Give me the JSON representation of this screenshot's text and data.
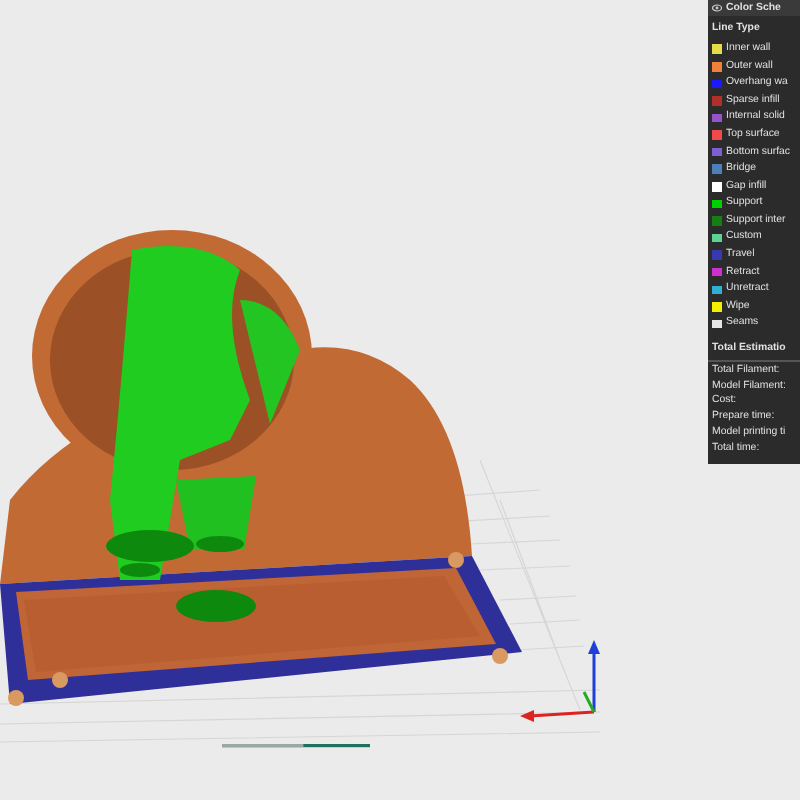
{
  "legend": {
    "title": "Color Sche",
    "section": "Line Type",
    "items": [
      {
        "label": "Inner wall",
        "color": "#e6dc4a"
      },
      {
        "label": "Outer wall",
        "color": "#f0803a"
      },
      {
        "label": "Overhang wa",
        "color": "#1a1aff"
      },
      {
        "label": "Sparse infill",
        "color": "#b03029"
      },
      {
        "label": "Internal solid",
        "color": "#9654cc"
      },
      {
        "label": "Top surface",
        "color": "#f04a4a"
      },
      {
        "label": "Bottom surfac",
        "color": "#7d5fd0"
      },
      {
        "label": "Bridge",
        "color": "#4d80ba"
      },
      {
        "label": "Gap infill",
        "color": "#ffffff"
      },
      {
        "label": "Support",
        "color": "#00d000"
      },
      {
        "label": "Support inter",
        "color": "#128012"
      },
      {
        "label": "Custom",
        "color": "#5ed194"
      },
      {
        "label": "Travel",
        "color": "#3838b0"
      },
      {
        "label": "Retract",
        "color": "#d030d0"
      },
      {
        "label": "Unretract",
        "color": "#30b0d0"
      },
      {
        "label": "Wipe",
        "color": "#f0f000"
      },
      {
        "label": "Seams",
        "color": "#e6e6e6"
      }
    ]
  },
  "slider": {
    "level": 0.55
  },
  "estimation": {
    "title": "Total Estimatio",
    "rows": [
      "Total Filament:",
      "Model Filament:",
      "Cost:",
      "Prepare time:",
      "Model printing ti",
      "Total time:"
    ]
  }
}
